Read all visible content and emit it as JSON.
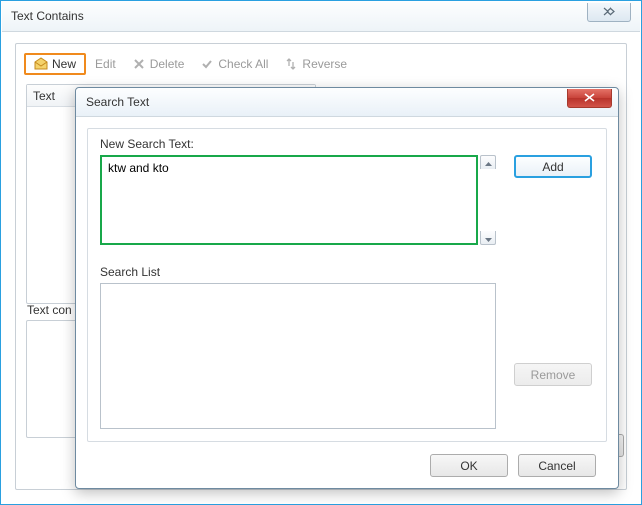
{
  "outer": {
    "title": "Text Contains",
    "toolbar": {
      "new": "New",
      "edit": "Edit",
      "delete": "Delete",
      "check_all": "Check All",
      "reverse": "Reverse"
    },
    "list_header": "Text",
    "list2_label": "Text con"
  },
  "dialog": {
    "title": "Search Text",
    "new_label": "New Search Text:",
    "new_value": "ktw and kto",
    "list_label": "Search List",
    "add": "Add",
    "remove": "Remove",
    "ok": "OK",
    "cancel": "Cancel"
  }
}
